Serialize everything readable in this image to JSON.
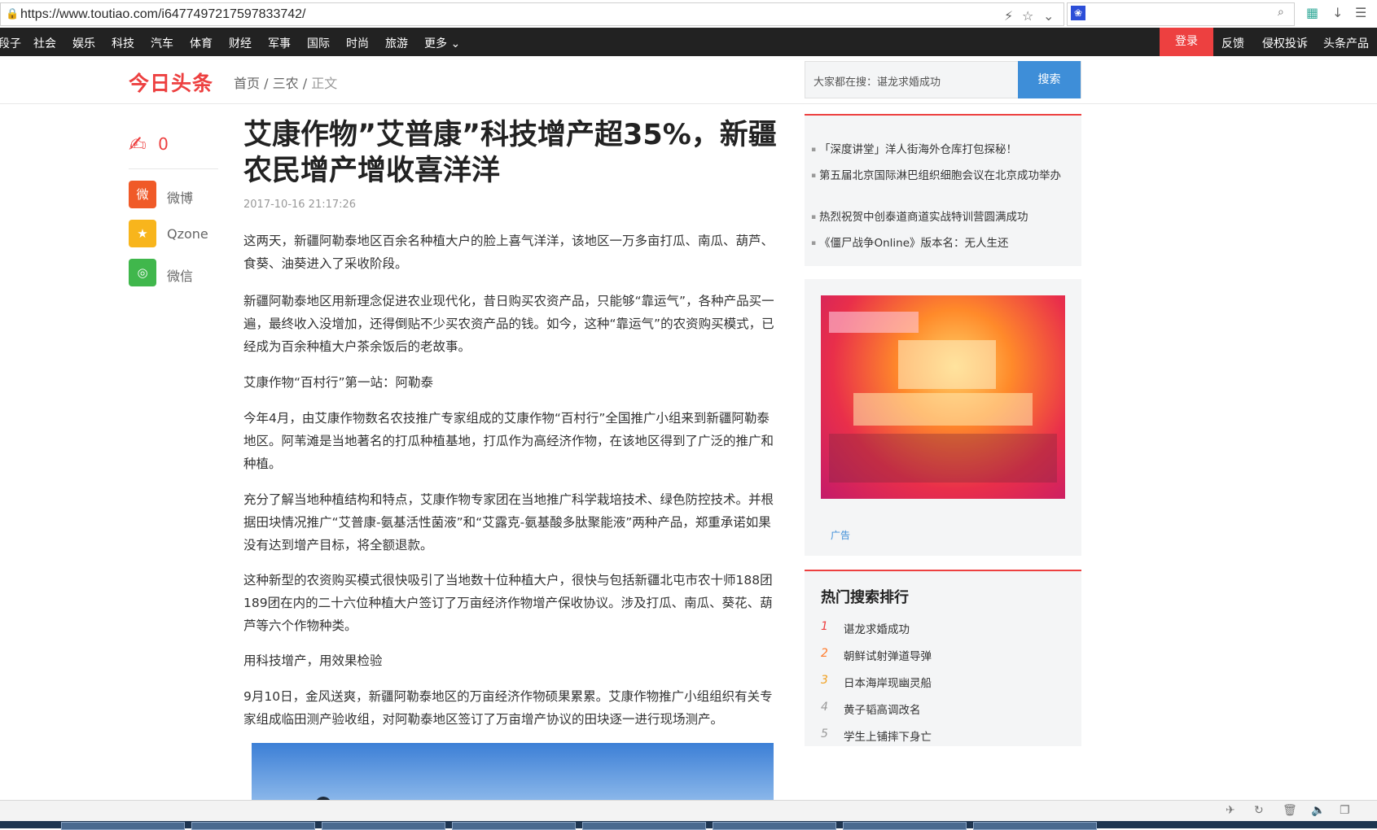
{
  "browser": {
    "url": "https://www.toutiao.com/i6477497217597833742/"
  },
  "topnav": {
    "items": [
      "段子",
      "社会",
      "娱乐",
      "科技",
      "汽车",
      "体育",
      "财经",
      "军事",
      "国际",
      "时尚",
      "旅游",
      "更多"
    ],
    "right_items": [
      "登录",
      "反馈",
      "侵权投诉",
      "头条产品"
    ]
  },
  "header": {
    "logo": "今日头条",
    "breadcrumb": [
      "首页",
      "三农",
      "正文"
    ],
    "search_placeholder": "大家都在搜：谌龙求婚成功",
    "search_button": "搜索"
  },
  "share": {
    "comment_count": "0",
    "items": [
      "微博",
      "Qzone",
      "微信"
    ]
  },
  "article": {
    "title": "艾康作物”艾普康”科技增产超35%，新疆农民增产增收喜洋洋",
    "time": "2017-10-16 21:17:26",
    "paragraphs": [
      "这两天，新疆阿勒泰地区百余名种植大户的脸上喜气洋洋，该地区一万多亩打瓜、南瓜、葫芦、食葵、油葵进入了采收阶段。",
      "新疆阿勒泰地区用新理念促进农业现代化，昔日购买农资产品，只能够“靠运气”，各种产品买一遍，最终收入没增加，还得倒贴不少买农资产品的钱。如今，这种“靠运气”的农资购买模式，已经成为百余种植大户茶余饭后的老故事。",
      "艾康作物“百村行”第一站：阿勒泰",
      "今年4月，由艾康作物数名农技推广专家组成的艾康作物“百村行”全国推广小组来到新疆阿勒泰地区。阿苇滩是当地著名的打瓜种植基地，打瓜作为高经济作物，在该地区得到了广泛的推广和种植。",
      "充分了解当地种植结构和特点，艾康作物专家团在当地推广科学栽培技术、绿色防控技术。并根据田块情况推广“艾普康-氨基活性菌液”和“艾露克-氨基酸多肽聚能液”两种产品，郑重承诺如果没有达到增产目标，将全额退款。",
      "这种新型的农资购买模式很快吸引了当地数十位种植大户，很快与包括新疆北屯市农十师188团189团在内的二十六位种植大户签订了万亩经济作物增产保收协议。涉及打瓜、南瓜、葵花、葫芦等六个作物种类。",
      "用科技增产，用效果检验",
      "9月10日，金风送爽，新疆阿勒泰地区的万亩经济作物硕果累累。艾康作物推广小组组织有关专家组成临田测产验收组，对阿勒泰地区签订了万亩增产协议的田块逐一进行现场测产。"
    ]
  },
  "sidebar": {
    "news": [
      "「深度讲堂」洋人街海外仓库打包探秘！",
      "第五届北京国际淋巴组织细胞会议在北京成功举办",
      "热烈祝贺中创泰道商道实战特训营圆满成功",
      "《僵尸战争Online》版本名：无人生还"
    ],
    "ad_label": "广告",
    "hot_title": "热门搜索排行",
    "hot": [
      {
        "rank": "1",
        "text": "谌龙求婚成功",
        "color": "#ed4040"
      },
      {
        "rank": "2",
        "text": "朝鲜试射弹道导弹",
        "color": "#ff7a2a"
      },
      {
        "rank": "3",
        "text": "日本海岸现幽灵船",
        "color": "#f0a020"
      },
      {
        "rank": "4",
        "text": "黄子韬高调改名",
        "color": "#999999"
      },
      {
        "rank": "5",
        "text": "学生上铺摔下身亡",
        "color": "#999999"
      }
    ]
  }
}
